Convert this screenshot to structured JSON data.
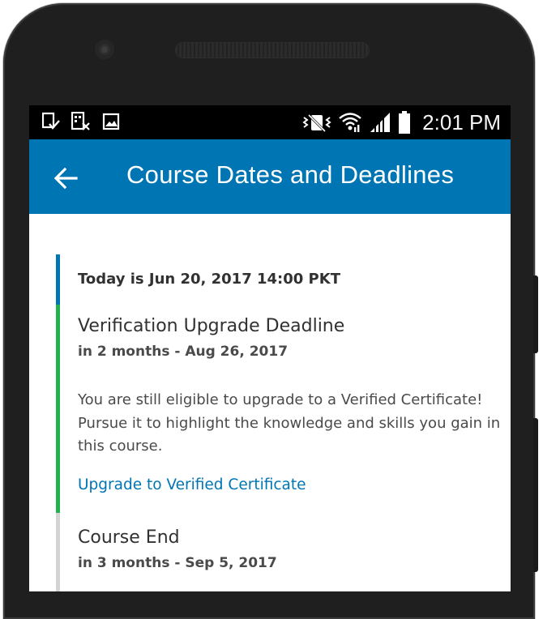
{
  "status_bar": {
    "time": "2:01 PM",
    "icons": [
      "notification-check-icon",
      "notification-image-off-icon",
      "image-icon",
      "vibrate-icon",
      "wifi-icon",
      "signal-icon",
      "battery-icon"
    ]
  },
  "app_bar": {
    "title": "Course Dates and Deadlines",
    "back_icon": "arrow-left-icon",
    "color": "#0075b4"
  },
  "timeline": {
    "today": {
      "text": "Today is Jun 20, 2017 14:00 PKT",
      "color": "#0075b4"
    },
    "verification": {
      "title": "Verification Upgrade Deadline",
      "subtitle": "in 2 months - Aug 26, 2017",
      "body": "You are still eligible to upgrade to a Verified Certificate! Pursue it to highlight the knowledge and skills you gain in this course.",
      "link": "Upgrade to Verified Certificate",
      "color": "#22b14c"
    },
    "course_end": {
      "title": "Course End",
      "subtitle": "in 3 months - Sep 5, 2017",
      "color": "#d3d3d3"
    }
  }
}
